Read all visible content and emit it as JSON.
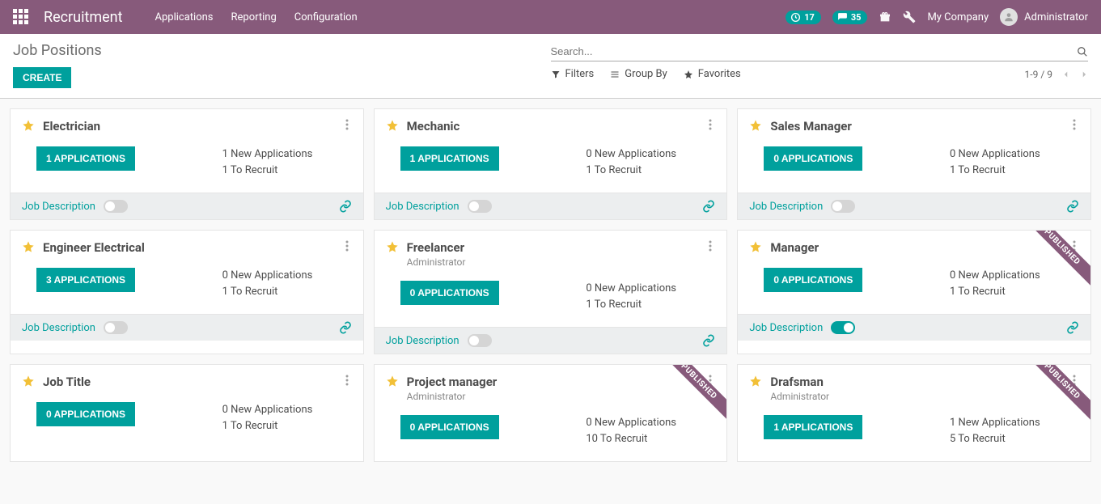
{
  "navbar": {
    "brand": "Recruitment",
    "menu": [
      "Applications",
      "Reporting",
      "Configuration"
    ],
    "activities_count": "17",
    "messages_count": "35",
    "company": "My Company",
    "user": "Administrator"
  },
  "controlpanel": {
    "title": "Job Positions",
    "create": "Create",
    "search_placeholder": "Search...",
    "filters": "Filters",
    "group_by": "Group By",
    "favorites": "Favorites",
    "pager": "1-9 / 9"
  },
  "labels": {
    "job_description": "Job Description",
    "published_ribbon": "PUBLISHED"
  },
  "cards": [
    {
      "title": "Electrician",
      "subtitle": "",
      "apps_btn": "1 Applications",
      "new_apps": "1 New Applications",
      "to_recruit": "1 To Recruit",
      "published": false
    },
    {
      "title": "Mechanic",
      "subtitle": "",
      "apps_btn": "1 Applications",
      "new_apps": "0 New Applications",
      "to_recruit": "1 To Recruit",
      "published": false
    },
    {
      "title": "Sales Manager",
      "subtitle": "",
      "apps_btn": "0 Applications",
      "new_apps": "0 New Applications",
      "to_recruit": "1 To Recruit",
      "published": false
    },
    {
      "title": "Engineer Electrical",
      "subtitle": "",
      "apps_btn": "3 Applications",
      "new_apps": "0 New Applications",
      "to_recruit": "1 To Recruit",
      "published": false
    },
    {
      "title": "Freelancer",
      "subtitle": "Administrator",
      "apps_btn": "0 Applications",
      "new_apps": "0 New Applications",
      "to_recruit": "1 To Recruit",
      "published": false
    },
    {
      "title": "Manager",
      "subtitle": "",
      "apps_btn": "0 Applications",
      "new_apps": "0 New Applications",
      "to_recruit": "1 To Recruit",
      "published": true
    },
    {
      "title": "Job Title",
      "subtitle": "",
      "apps_btn": "0 Applications",
      "new_apps": "0 New Applications",
      "to_recruit": "1 To Recruit",
      "published": false
    },
    {
      "title": "Project manager",
      "subtitle": "Administrator",
      "apps_btn": "0 Applications",
      "new_apps": "0 New Applications",
      "to_recruit": "10 To Recruit",
      "published": true
    },
    {
      "title": "Drafsman",
      "subtitle": "Administrator",
      "apps_btn": "1 Applications",
      "new_apps": "1 New Applications",
      "to_recruit": "5 To Recruit",
      "published": true
    }
  ]
}
